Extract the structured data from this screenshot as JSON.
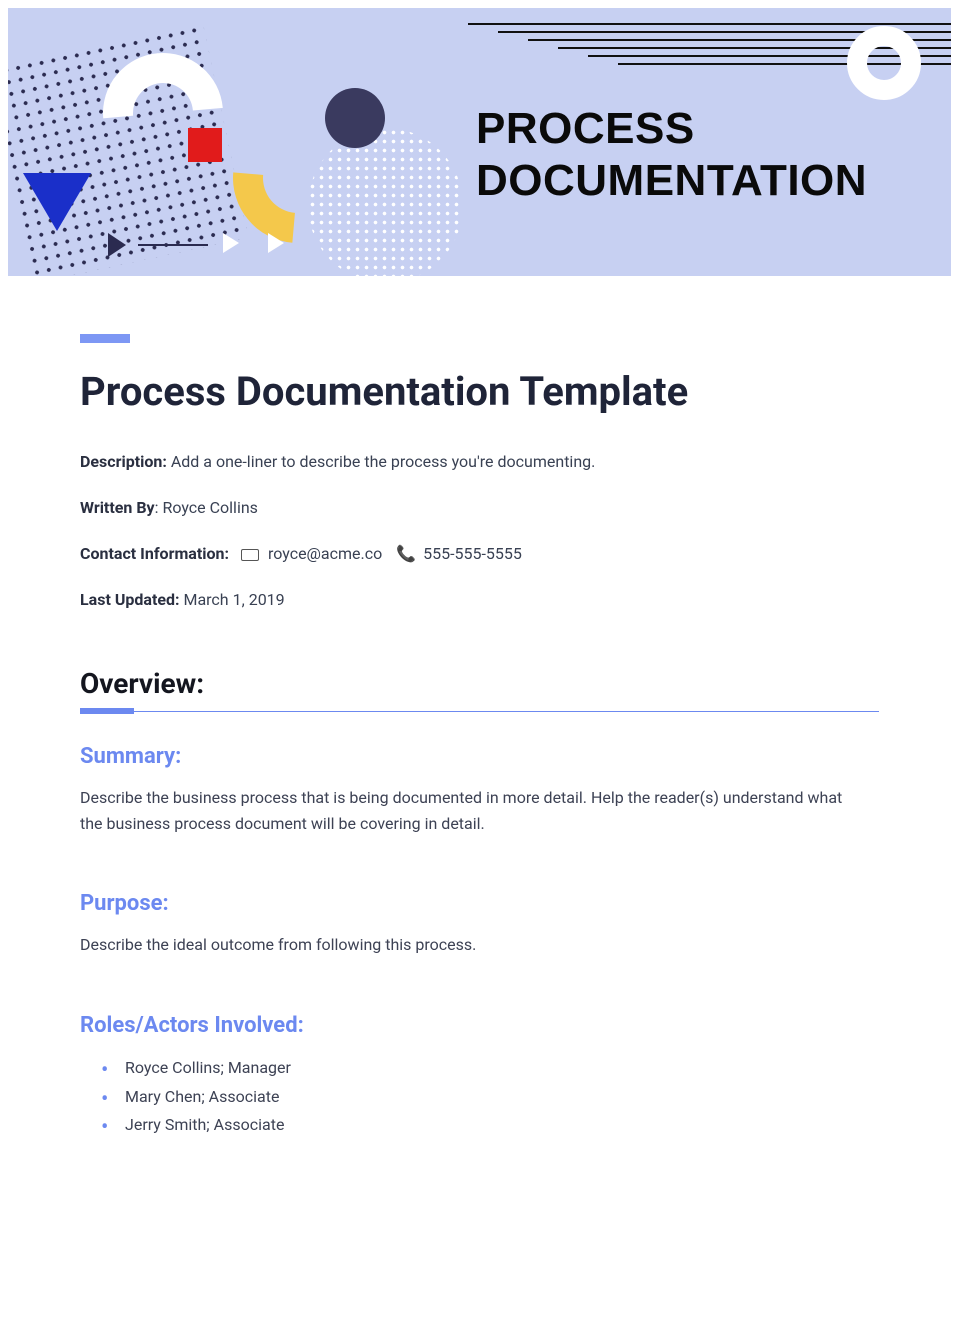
{
  "banner": {
    "title": "PROCESS\nDOCUMENTATION"
  },
  "doc": {
    "title": "Process Documentation Template",
    "description_label": "Description:",
    "description_value": " Add a one-liner to describe the process you're documenting.",
    "writtenby_label": "Written By",
    "writtenby_value": ": Royce Collins",
    "contact_label": "Contact Information:",
    "contact_email": "royce@acme.co",
    "contact_phone": "555-555-5555",
    "updated_label": "Last Updated:",
    "updated_value": " March 1, 2019"
  },
  "overview": {
    "heading": "Overview:",
    "summary_heading": "Summary:",
    "summary_body": "Describe the business process that is being documented in more detail. Help the reader(s) understand what the business process document will be covering in detail.",
    "purpose_heading": "Purpose:",
    "purpose_body": "Describe the ideal outcome from following this process.",
    "roles_heading": "Roles/Actors Involved:",
    "roles": [
      "Royce Collins; Manager",
      "Mary Chen; Associate",
      "Jerry Smith; Associate"
    ]
  }
}
